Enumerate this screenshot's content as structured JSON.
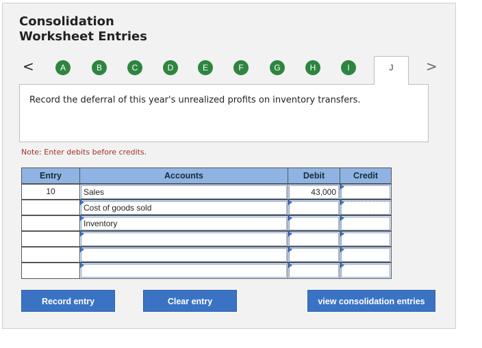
{
  "header": {
    "title_line1": "Consolidation",
    "title_line2": "Worksheet Entries"
  },
  "tabs": {
    "prev": "<",
    "next": ">",
    "items": [
      "A",
      "B",
      "C",
      "D",
      "E",
      "F",
      "G",
      "H",
      "I",
      "J"
    ],
    "active": "J"
  },
  "instruction": "Record the deferral of this year's unrealized profits on inventory transfers.",
  "note": "Note: Enter debits before credits.",
  "table": {
    "headers": {
      "entry": "Entry",
      "accounts": "Accounts",
      "debit": "Debit",
      "credit": "Credit"
    },
    "rows": [
      {
        "entry": "10",
        "account": "Sales",
        "debit": "43,000",
        "credit": ""
      },
      {
        "entry": "",
        "account": "Cost of goods sold",
        "debit": "",
        "credit": ""
      },
      {
        "entry": "",
        "account": "Inventory",
        "debit": "",
        "credit": ""
      },
      {
        "entry": "",
        "account": "",
        "debit": "",
        "credit": ""
      },
      {
        "entry": "",
        "account": "",
        "debit": "",
        "credit": ""
      },
      {
        "entry": "",
        "account": "",
        "debit": "",
        "credit": ""
      }
    ]
  },
  "buttons": {
    "record": "Record entry",
    "clear": "Clear entry",
    "view": "view consolidation entries"
  },
  "colors": {
    "tab_green": "#2e8540",
    "header_blue": "#8fb4e3",
    "button_blue": "#3b73c4",
    "note_red": "#a0302a"
  }
}
